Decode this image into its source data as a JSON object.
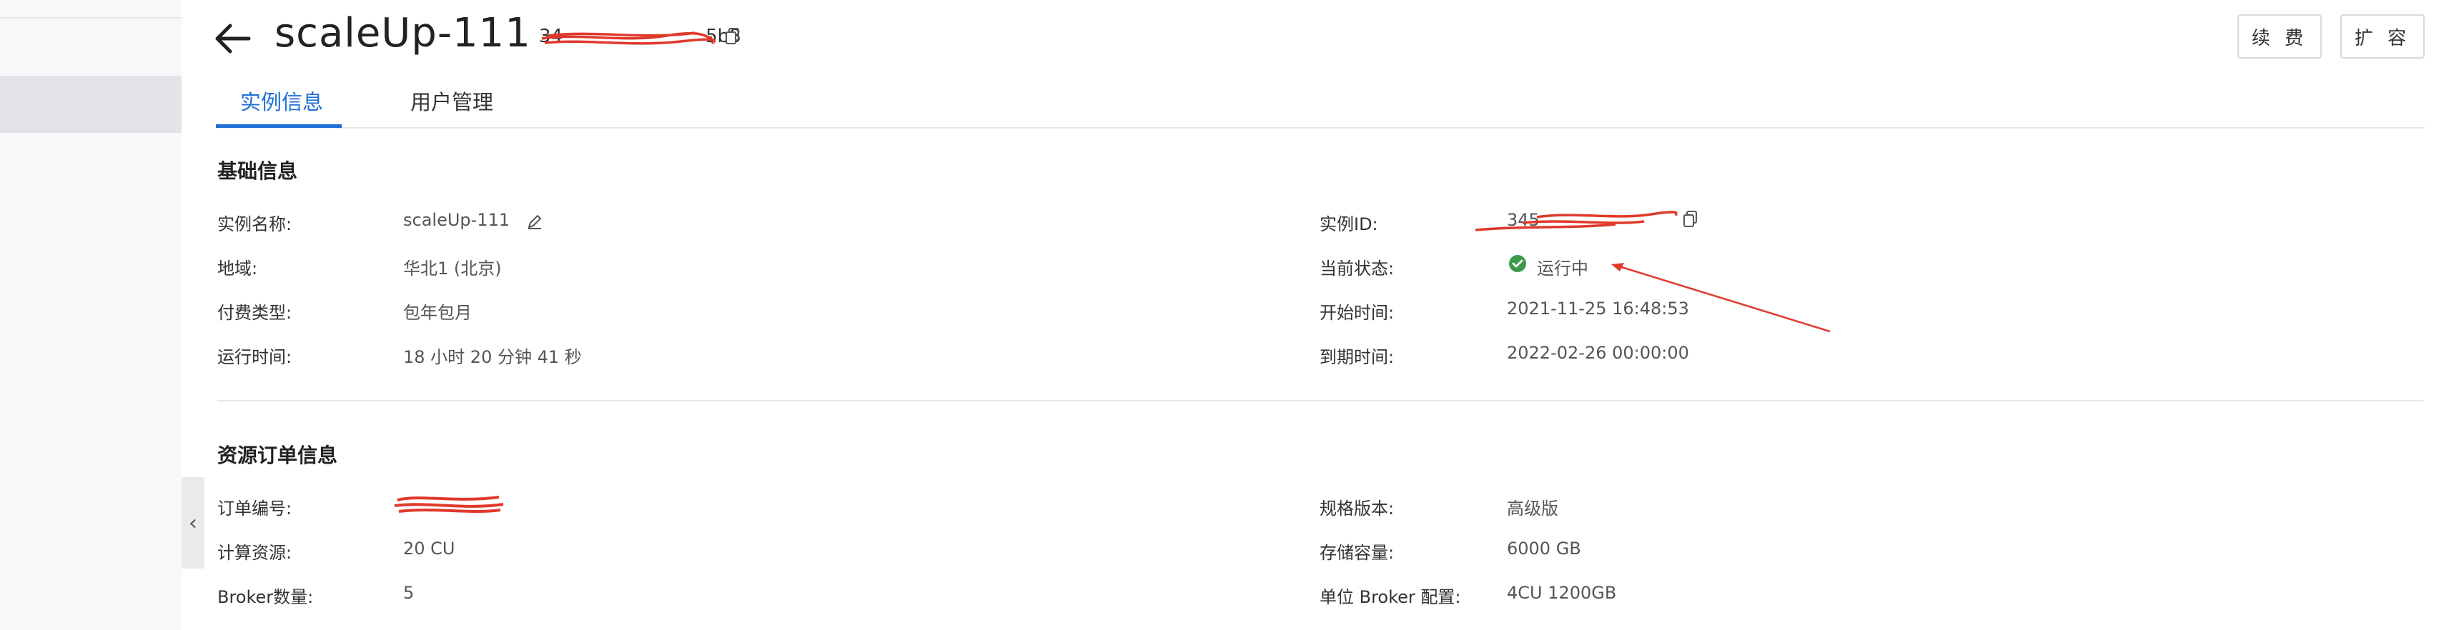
{
  "header": {
    "title": "scaleUp-111",
    "instance_id_partial": "34",
    "instance_id_tail": "5b8",
    "buttons": [
      "续 费",
      "扩 容"
    ]
  },
  "tabs": [
    {
      "label": "实例信息",
      "active": true
    },
    {
      "label": "用户管理",
      "active": false
    }
  ],
  "basic_info": {
    "title": "基础信息",
    "left": [
      {
        "label": "实例名称:",
        "value": "scaleUp-111"
      },
      {
        "label": "地域:",
        "value": "华北1 (北京)"
      },
      {
        "label": "付费类型:",
        "value": "包年包月"
      },
      {
        "label": "运行时间:",
        "value": "18 小时 20 分钟 41 秒"
      }
    ],
    "right": [
      {
        "label": "实例ID:",
        "value": "345"
      },
      {
        "label": "当前状态:",
        "value": "运行中"
      },
      {
        "label": "开始时间:",
        "value": "2021-11-25 16:48:53"
      },
      {
        "label": "到期时间:",
        "value": "2022-02-26 00:00:00"
      }
    ]
  },
  "order_info": {
    "title": "资源订单信息",
    "left": [
      {
        "label": "订单编号:",
        "value": ""
      },
      {
        "label": "计算资源:",
        "value": "20 CU"
      },
      {
        "label": "Broker数量:",
        "value": "5"
      }
    ],
    "right": [
      {
        "label": "规格版本:",
        "value": "高级版"
      },
      {
        "label": "存储容量:",
        "value": "6000 GB"
      },
      {
        "label": "单位 Broker 配置:",
        "value": "4CU 1200GB"
      }
    ]
  },
  "colors": {
    "accent": "#1f6fd6",
    "status_ok": "#3c9a4a",
    "annotation": "#e0392b"
  },
  "icons": [
    "back-arrow-icon",
    "copy-icon",
    "edit-icon",
    "check-circle-icon",
    "chevron-left-icon"
  ]
}
